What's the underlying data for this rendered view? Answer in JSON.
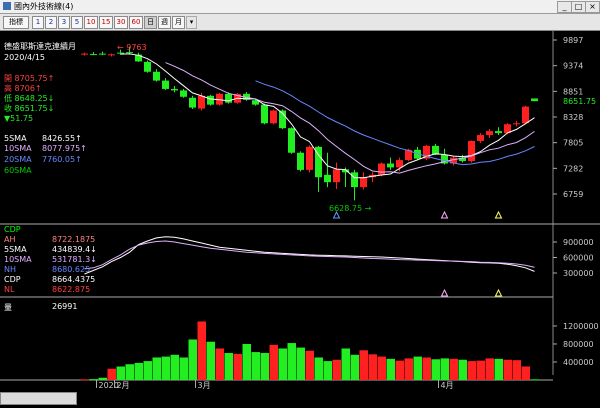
{
  "window": {
    "title": "國內外技術線(4)",
    "btn_min": "_",
    "btn_max": "□",
    "btn_close": "×"
  },
  "toolbar": {
    "left_label": "指標",
    "period_buttons": [
      "1",
      "2",
      "3",
      "5",
      "10",
      "15",
      "30",
      "60"
    ],
    "icon_buttons": [
      "日",
      "週",
      "月"
    ]
  },
  "instrument": {
    "name": "德盛耶斯達克連續月",
    "date": "2020/4/15",
    "high_marker": "← 9763",
    "low_marker": "6628.75 →"
  },
  "quote": {
    "open_label": "開",
    "open_value": "8705.75↑",
    "high_label": "高",
    "high_value": "8706↑",
    "low_label": "低",
    "low_value": "8648.25↓",
    "close_label": "收",
    "close_value": "8651.75↓",
    "change": "▼51.75"
  },
  "sma": [
    {
      "label": "5SMA",
      "value": "8426.55↑",
      "color": "#ffffff"
    },
    {
      "label": "10SMA",
      "value": "8077.975↑",
      "color": "#e0b0ff"
    },
    {
      "label": "20SMA",
      "value": "7760.05↑",
      "color": "#6688ff"
    },
    {
      "label": "60SMA",
      "value": "",
      "color": "#00cc00"
    }
  ],
  "cdp": [
    {
      "label": "CDP",
      "value": "",
      "color": "#00ff00"
    },
    {
      "label": "AH",
      "value": "8722.1875",
      "color": "#ff8080"
    },
    {
      "label": "5SMA",
      "value": "434839.4↓",
      "color": "#ffffff"
    },
    {
      "label": "10SMA",
      "value": "531781.3↓",
      "color": "#e0b0ff"
    },
    {
      "label": "NH",
      "value": "8680.625",
      "color": "#6688ff"
    },
    {
      "label": "CDP",
      "value": "8664.4375",
      "color": "#ffffff"
    },
    {
      "label": "NL",
      "value": "8622.875",
      "color": "#ff4040"
    }
  ],
  "volume": {
    "label": "量",
    "value": "26991"
  },
  "price_axis": {
    "ticks": [
      "9897",
      "9374",
      "8851",
      "8328",
      "7805",
      "7282",
      "6759"
    ],
    "last_price": "8651.75"
  },
  "cdp_axis": {
    "ticks": [
      "900000",
      "600000",
      "300000"
    ]
  },
  "vol_axis": {
    "ticks": [
      "1200000",
      "800000",
      "400000"
    ]
  },
  "date_axis": {
    "labels": [
      "2020",
      "2月",
      "3月",
      "4月"
    ]
  },
  "colors": {
    "up": "#ff2020",
    "down": "#22ee22",
    "bg": "#000000",
    "axis": "#aaaaaa",
    "last_price_tag": "#00aa00"
  },
  "chart_data": {
    "type": "bar",
    "candles": [
      {
        "o": 9600,
        "h": 9640,
        "l": 9580,
        "c": 9620
      },
      {
        "o": 9610,
        "h": 9650,
        "l": 9590,
        "c": 9600
      },
      {
        "o": 9620,
        "h": 9660,
        "l": 9590,
        "c": 9600
      },
      {
        "o": 9590,
        "h": 9620,
        "l": 9560,
        "c": 9605
      },
      {
        "o": 9640,
        "h": 9700,
        "l": 9600,
        "c": 9620
      },
      {
        "o": 9650,
        "h": 9763,
        "l": 9620,
        "c": 9640
      },
      {
        "o": 9600,
        "h": 9640,
        "l": 9450,
        "c": 9460
      },
      {
        "o": 9450,
        "h": 9480,
        "l": 9230,
        "c": 9250
      },
      {
        "o": 9250,
        "h": 9300,
        "l": 9050,
        "c": 9070
      },
      {
        "o": 9070,
        "h": 9120,
        "l": 8880,
        "c": 8900
      },
      {
        "o": 8900,
        "h": 8960,
        "l": 8830,
        "c": 8870
      },
      {
        "o": 8870,
        "h": 8900,
        "l": 8720,
        "c": 8740
      },
      {
        "o": 8720,
        "h": 8760,
        "l": 8490,
        "c": 8520
      },
      {
        "o": 8500,
        "h": 8820,
        "l": 8460,
        "c": 8760
      },
      {
        "o": 8760,
        "h": 8780,
        "l": 8560,
        "c": 8580
      },
      {
        "o": 8580,
        "h": 8820,
        "l": 8560,
        "c": 8800
      },
      {
        "o": 8800,
        "h": 8830,
        "l": 8600,
        "c": 8620
      },
      {
        "o": 8620,
        "h": 8820,
        "l": 8600,
        "c": 8800
      },
      {
        "o": 8800,
        "h": 8840,
        "l": 8660,
        "c": 8680
      },
      {
        "o": 8670,
        "h": 8700,
        "l": 8560,
        "c": 8580
      },
      {
        "o": 8580,
        "h": 8600,
        "l": 8180,
        "c": 8200
      },
      {
        "o": 8200,
        "h": 8480,
        "l": 8180,
        "c": 8460
      },
      {
        "o": 8460,
        "h": 8480,
        "l": 8080,
        "c": 8100
      },
      {
        "o": 8100,
        "h": 8120,
        "l": 7580,
        "c": 7600
      },
      {
        "o": 7600,
        "h": 7630,
        "l": 7220,
        "c": 7250
      },
      {
        "o": 7250,
        "h": 7750,
        "l": 7200,
        "c": 7720
      },
      {
        "o": 7720,
        "h": 7740,
        "l": 6800,
        "c": 7100
      },
      {
        "o": 7150,
        "h": 7600,
        "l": 6900,
        "c": 7000
      },
      {
        "o": 7000,
        "h": 7400,
        "l": 6860,
        "c": 7260
      },
      {
        "o": 7260,
        "h": 7300,
        "l": 6900,
        "c": 7200
      },
      {
        "o": 7200,
        "h": 7250,
        "l": 6628.75,
        "c": 6900
      },
      {
        "o": 6900,
        "h": 7200,
        "l": 6850,
        "c": 7100
      },
      {
        "o": 7100,
        "h": 7200,
        "l": 7000,
        "c": 7150
      },
      {
        "o": 7150,
        "h": 7400,
        "l": 7120,
        "c": 7380
      },
      {
        "o": 7380,
        "h": 7500,
        "l": 7250,
        "c": 7300
      },
      {
        "o": 7300,
        "h": 7500,
        "l": 7220,
        "c": 7450
      },
      {
        "o": 7450,
        "h": 7680,
        "l": 7430,
        "c": 7660
      },
      {
        "o": 7660,
        "h": 7720,
        "l": 7450,
        "c": 7480
      },
      {
        "o": 7480,
        "h": 7760,
        "l": 7450,
        "c": 7740
      },
      {
        "o": 7740,
        "h": 7780,
        "l": 7550,
        "c": 7560
      },
      {
        "o": 7560,
        "h": 7680,
        "l": 7360,
        "c": 7380
      },
      {
        "o": 7380,
        "h": 7520,
        "l": 7340,
        "c": 7500
      },
      {
        "o": 7500,
        "h": 7560,
        "l": 7400,
        "c": 7430
      },
      {
        "o": 7430,
        "h": 7850,
        "l": 7400,
        "c": 7840
      },
      {
        "o": 7840,
        "h": 8000,
        "l": 7800,
        "c": 7960
      },
      {
        "o": 7960,
        "h": 8080,
        "l": 7900,
        "c": 8040
      },
      {
        "o": 8040,
        "h": 8120,
        "l": 7960,
        "c": 8000
      },
      {
        "o": 8000,
        "h": 8200,
        "l": 7980,
        "c": 8180
      },
      {
        "o": 8180,
        "h": 8250,
        "l": 8140,
        "c": 8200
      },
      {
        "o": 8200,
        "h": 8560,
        "l": 8180,
        "c": 8540
      },
      {
        "o": 8705.75,
        "h": 8706,
        "l": 8648.25,
        "c": 8651.75
      }
    ],
    "volumes": [
      15000,
      20000,
      50000,
      250000,
      300000,
      350000,
      380000,
      420000,
      500000,
      520000,
      560000,
      500000,
      900000,
      1300000,
      850000,
      700000,
      600000,
      580000,
      800000,
      620000,
      600000,
      780000,
      700000,
      820000,
      720000,
      650000,
      500000,
      420000,
      450000,
      700000,
      560000,
      660000,
      570000,
      520000,
      470000,
      430000,
      480000,
      520000,
      500000,
      460000,
      480000,
      470000,
      450000,
      420000,
      430000,
      480000,
      470000,
      450000,
      440000,
      300000,
      15000
    ],
    "cdp_series": [
      280000,
      350000,
      420000,
      520000,
      600000,
      700000,
      850000,
      920000,
      980000,
      1000000,
      990000,
      960000,
      920000,
      880000,
      840000,
      800000,
      780000,
      760000,
      740000,
      720000,
      700000,
      690000,
      680000,
      670000,
      660000,
      650000,
      645000,
      640000,
      635000,
      630000,
      625000,
      620000,
      615000,
      610000,
      600000,
      590000,
      580000,
      570000,
      560000,
      550000,
      540000,
      530000,
      520000,
      510000,
      500000,
      495000,
      490000,
      470000,
      440000,
      400000,
      330000
    ],
    "cdp_series2": [
      380000,
      400000,
      460000,
      560000,
      650000,
      760000,
      840000,
      880000,
      910000,
      920000,
      900000,
      870000,
      840000,
      810000,
      780000,
      760000,
      740000,
      720000,
      700000,
      690000,
      680000,
      670000,
      660000,
      650000,
      640000,
      630000,
      625000,
      620000,
      615000,
      610000,
      600000,
      590000,
      580000,
      575000,
      570000,
      560000,
      555000,
      550000,
      545000,
      540000,
      535000,
      530000,
      525000,
      520000,
      510000,
      505000,
      500000,
      490000,
      475000,
      450000,
      410000
    ]
  }
}
